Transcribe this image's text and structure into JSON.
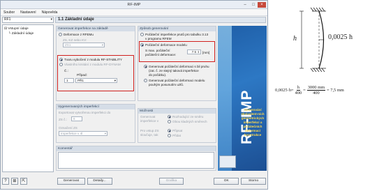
{
  "window": {
    "title": "RF-IMP"
  },
  "menu": [
    "Soubor",
    "Nastavení",
    "Nápověda"
  ],
  "case_select": "RF1",
  "page_title": "1.1 Základní údaje",
  "tree": {
    "root": "Vstupní údaje",
    "child": "Základní údaje"
  },
  "gen": {
    "title": "Generovat imperfekce na základě",
    "opt1": "Deformace z RFEMu",
    "lbl_zs": "ZS, KZ nebo KV:",
    "zs_val": "ZS1",
    "opt2": "Tvaru vybočení z modulu RF-STABILITY",
    "opt3": "Vlastního kmitání z modulu RF-DYNAM",
    "lbl_c": "Č.:",
    "lbl_case": "Případ:",
    "c_val": "1",
    "case_val": "PŘ1"
  },
  "method": {
    "title": "Způsob generování",
    "opt1a": "Počáteční imperfekce prutů pro tabulku 3.13",
    "opt1b": "v programu RFEM",
    "opt2": "Počáteční deformace modelu",
    "lbl_max1": "S max. počáteční",
    "lbl_max2": "počáteční deformace:",
    "max_val": "7.5",
    "unit": "[mm]",
    "sub1a": "Generovat počáteční deformaci s bil pruhu",
    "sub1b": "(zat. č. ze stejný taková imperfekce",
    "sub1c": "do počátku).",
    "sub2a": "Generovat počáteční deformaci modelu",
    "sub2b": "pouhým posunutím uzlů."
  },
  "superpos": {
    "title": "Vygenerovaných imperfekcí",
    "lbl1": "Exportovat vytvořenou imperfekci do",
    "zs_lbl": "ZS č.:",
    "zs_val": "6",
    "lbl2": "Označení ZS",
    "name_val": "Imperfekce v 4l"
  },
  "options": {
    "title": "Možnosti",
    "l1": "Generovat",
    "l1b": "imperfekce v",
    "r1": "Rozhodující ze směru",
    "r2": "Obou kladných směrech",
    "l2": "Pro vstup ZS",
    "l2b": "sloučuje, tak",
    "r3": "Připsat",
    "r4": "Přidat"
  },
  "comment": {
    "title": "Komentář"
  },
  "banner": {
    "text": "RF-IMP",
    "desc": "Generování ekvivalent-ních geometrických imperfekcí a počátečních deformací konstrukce"
  },
  "buttons": {
    "generate": "Generovat",
    "details": "Detaily...",
    "graphics": "Grafika",
    "ok": "OK",
    "cancel": "Storno"
  },
  "annotation": {
    "h": "h",
    "formula_h": "0,0025 h",
    "left": "0,0025·h=",
    "frac1_num": "h",
    "frac1_den": "400",
    "eq": "=",
    "frac2_num": "3000 mm",
    "frac2_den": "400",
    "result": "= 7,5 mm"
  }
}
